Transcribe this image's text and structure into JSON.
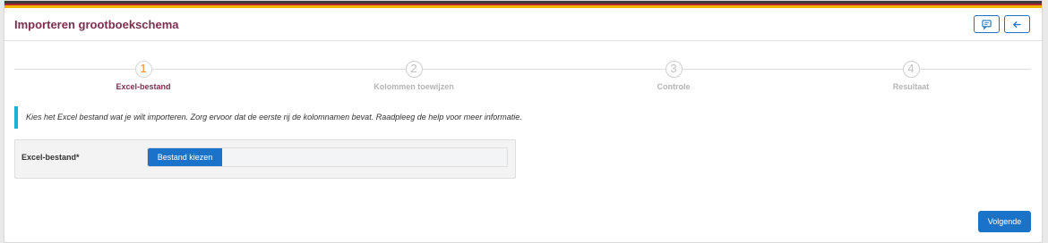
{
  "header": {
    "title": "Importeren grootboekschema",
    "comment_icon": "comment-icon",
    "back_icon": "arrow-left-icon",
    "accent_color": "#7b2f4f",
    "primary_color": "#1b73c9"
  },
  "stepper": {
    "steps": [
      {
        "number": "1",
        "label": "Excel-bestand",
        "active": true
      },
      {
        "number": "2",
        "label": "Kolommen toewijzen",
        "active": false
      },
      {
        "number": "3",
        "label": "Controle",
        "active": false
      },
      {
        "number": "4",
        "label": "Resultaat",
        "active": false
      }
    ]
  },
  "info": {
    "text": "Kies het Excel bestand wat je wilt importeren. Zorg ervoor dat de eerste rij de kolomnamen bevat. Raadpleeg de help voor meer informatie."
  },
  "form": {
    "file_label": "Excel-bestand*",
    "file_button": "Bestand kiezen"
  },
  "footer": {
    "next_label": "Volgende"
  }
}
